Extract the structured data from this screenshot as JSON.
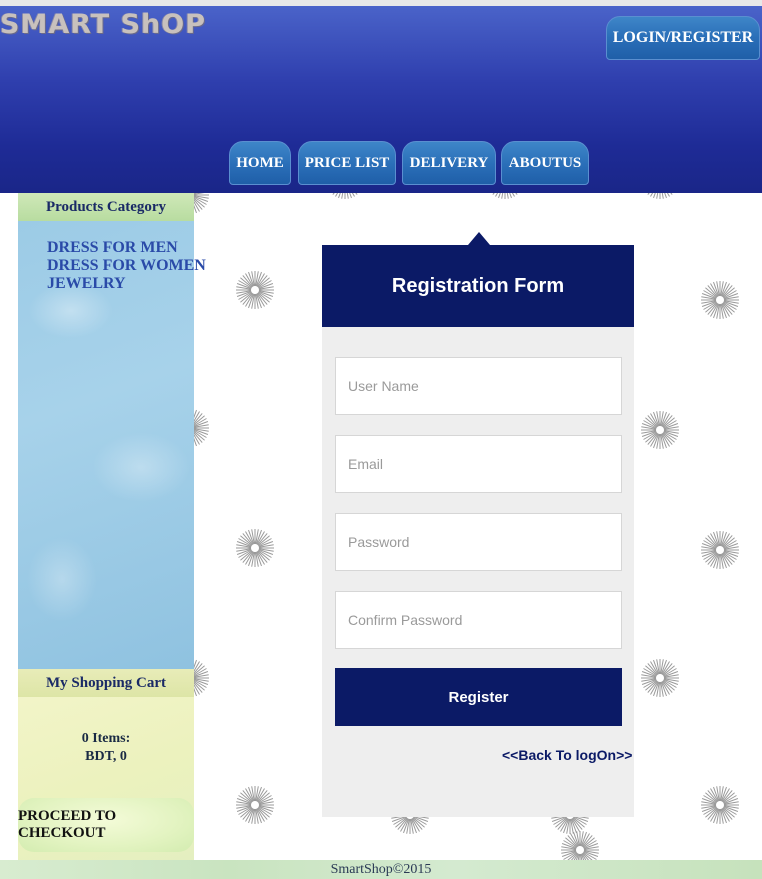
{
  "header": {
    "logo": "SMART ShOP",
    "login_label": "LOGIN/REGISTER",
    "nav": [
      "HOME",
      "PRICE LIST",
      "DELIVERY",
      "ABOUTUS"
    ]
  },
  "sidebar": {
    "category_title": "Products Category",
    "categories": [
      "DRESS FOR MEN",
      "DRESS FOR WOMEN",
      "JEWELRY"
    ],
    "cart_title": "My Shopping Cart",
    "cart_items": "0 Items:",
    "cart_total": "BDT, 0",
    "checkout_label": "PROCEED TO CHECKOUT"
  },
  "form": {
    "title": "Registration Form",
    "username_placeholder": "User Name",
    "email_placeholder": "Email",
    "password_placeholder": "Password",
    "confirm_placeholder": "Confirm Password",
    "register_label": "Register",
    "back_link": "<<Back To logOn>>"
  },
  "footer": {
    "copyright": "SmartShop©2015"
  },
  "colors": {
    "header_blue": "#1e2b96",
    "nav_button": "#2a6eb8",
    "form_navy": "#0b1a66"
  }
}
